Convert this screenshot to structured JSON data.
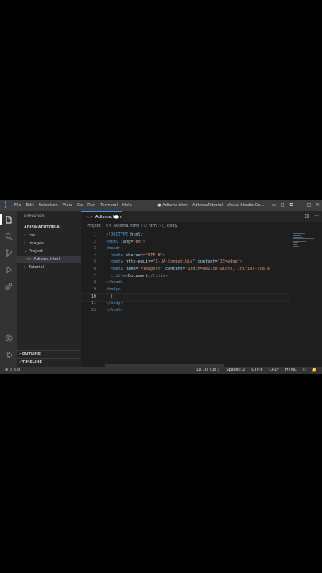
{
  "titlebar": {
    "menu": [
      "File",
      "Edit",
      "Selection",
      "View",
      "Go",
      "Run",
      "Terminal",
      "Help"
    ],
    "window_title": "● Adisma.html - AdismaTutorial - Visual Studio Co...",
    "controls": [
      "▭",
      "▯",
      "⧉",
      "—",
      "□",
      "✕"
    ]
  },
  "sidebar": {
    "header": "EXPLORER",
    "header_actions": "···",
    "root": "ADISMATUTORIAL",
    "items": [
      {
        "label": "css",
        "chev": "›"
      },
      {
        "label": "images",
        "chev": "›"
      },
      {
        "label": "Project",
        "chev": "⌄"
      },
      {
        "label": "Adisma.html",
        "icon": "<>"
      },
      {
        "label": "Tutorial",
        "chev": "›"
      }
    ],
    "outline": "OUTLINE",
    "timeline": "TIMELINE"
  },
  "editor": {
    "tab_label": "Adisma.html",
    "tab_dirty": "●",
    "breadcrumb": "Project › <> Adisma.html › ⬡ html › ⬡ body",
    "lines": [
      {
        "n": "1",
        "indent": "",
        "parts": [
          [
            "p",
            "<!"
          ],
          [
            "t",
            "DOCTYPE"
          ],
          [
            "a",
            " html"
          ],
          [
            "p",
            ">"
          ]
        ]
      },
      {
        "n": "2",
        "indent": "",
        "parts": [
          [
            "p",
            "<"
          ],
          [
            "t",
            "html"
          ],
          [
            "a",
            " lang"
          ],
          [
            "x",
            "="
          ],
          [
            "s",
            "\"en\""
          ],
          [
            "p",
            ">"
          ]
        ]
      },
      {
        "n": "3",
        "indent": "",
        "parts": [
          [
            "p",
            "<"
          ],
          [
            "t",
            "head"
          ],
          [
            "p",
            ">"
          ]
        ]
      },
      {
        "n": "4",
        "indent": "  ",
        "parts": [
          [
            "p",
            "<"
          ],
          [
            "t",
            "meta"
          ],
          [
            "a",
            " charset"
          ],
          [
            "x",
            "="
          ],
          [
            "s",
            "\"UTF-8\""
          ],
          [
            "p",
            ">"
          ]
        ]
      },
      {
        "n": "5",
        "indent": "  ",
        "parts": [
          [
            "p",
            "<"
          ],
          [
            "t",
            "meta"
          ],
          [
            "a",
            " http-equiv"
          ],
          [
            "x",
            "="
          ],
          [
            "s",
            "\"X-UA-Compatible\""
          ],
          [
            "a",
            " content"
          ],
          [
            "x",
            "="
          ],
          [
            "s",
            "\"IE=edge\""
          ],
          [
            "p",
            ">"
          ]
        ]
      },
      {
        "n": "6",
        "indent": "  ",
        "parts": [
          [
            "p",
            "<"
          ],
          [
            "t",
            "meta"
          ],
          [
            "a",
            " name"
          ],
          [
            "x",
            "="
          ],
          [
            "s",
            "\"viewport\""
          ],
          [
            "a",
            " content"
          ],
          [
            "x",
            "="
          ],
          [
            "s",
            "\"width=device-width, initial-scale"
          ]
        ]
      },
      {
        "n": "7",
        "indent": "  ",
        "parts": [
          [
            "p",
            "<"
          ],
          [
            "t",
            "title"
          ],
          [
            "p",
            ">"
          ],
          [
            "x",
            "Document"
          ],
          [
            "p",
            "</"
          ],
          [
            "t",
            "title"
          ],
          [
            "p",
            ">"
          ]
        ]
      },
      {
        "n": "8",
        "indent": "",
        "parts": [
          [
            "p",
            "</"
          ],
          [
            "t",
            "head"
          ],
          [
            "p",
            ">"
          ]
        ]
      },
      {
        "n": "9",
        "indent": "",
        "parts": [
          [
            "p",
            "<"
          ],
          [
            "t",
            "body"
          ],
          [
            "p",
            ">"
          ]
        ]
      },
      {
        "n": "10",
        "indent": "  ",
        "parts": [
          [
            "x",
            "|"
          ]
        ]
      },
      {
        "n": "11",
        "indent": "",
        "parts": [
          [
            "p",
            "</"
          ],
          [
            "t",
            "body"
          ],
          [
            "p",
            ">"
          ]
        ]
      },
      {
        "n": "12",
        "indent": "",
        "parts": [
          [
            "p",
            "</"
          ],
          [
            "t",
            "html"
          ],
          [
            "p",
            ">"
          ]
        ]
      }
    ]
  },
  "statusbar": {
    "left": "⊗ 0 ⚠ 0",
    "position": "Ln 10, Col 3",
    "spaces": "Spaces: 2",
    "encoding": "UTF-8",
    "eol": "CRLF",
    "language": "HTML",
    "feedback": "⚇",
    "bell": "🔔"
  },
  "colors": {
    "tag": "#569cd6",
    "attr": "#9cdcfe",
    "string": "#ce9178",
    "punct": "#808080",
    "html_icon": "#e37933"
  }
}
